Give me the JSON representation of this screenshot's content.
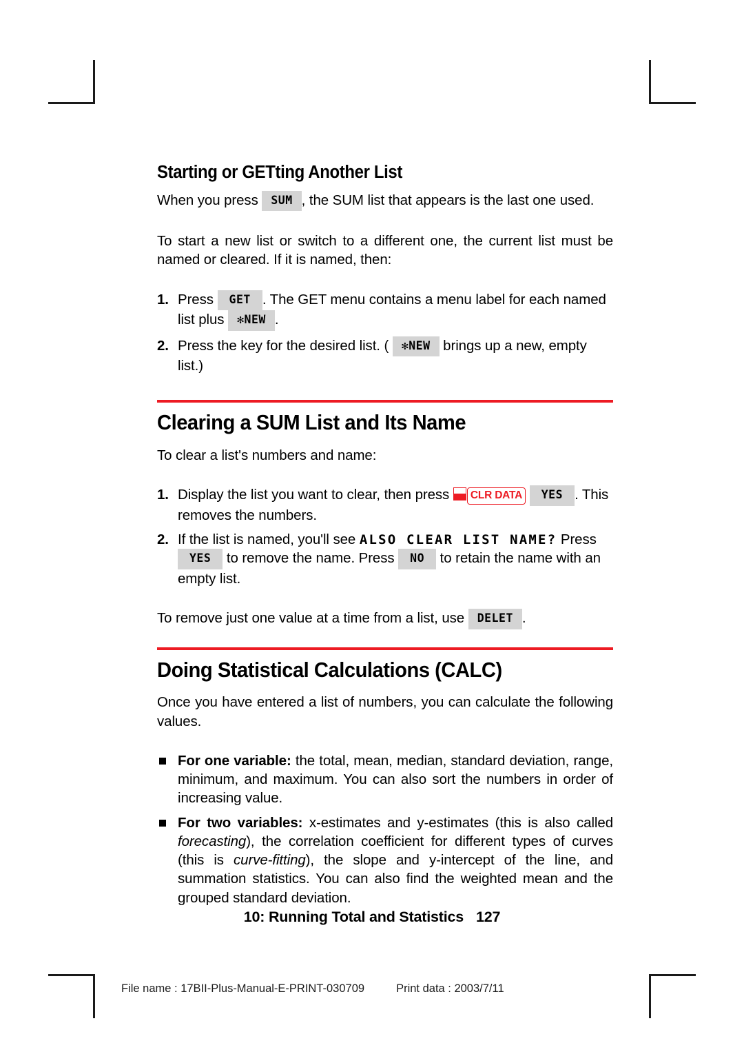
{
  "document": {
    "page_number": "127",
    "running_footer": "10: Running Total and Statistics",
    "print_footer": {
      "file_name_label": "File name : 17BII-Plus-Manual-E-PRINT-030709",
      "print_date_label": "Print data : 2003/7/11"
    },
    "accent_color": "#ED1B23",
    "key_bg_color": "#D4D4D4"
  },
  "sections": [
    {
      "id": "starting-or-getting",
      "heading": "Starting or GETting Another List",
      "intro": {
        "pre": "When you press",
        "key": "SUM",
        "post": ", the SUM list that appears is the last one used."
      },
      "paragraph": "To start a new list or switch to a different one, the current list must be named or cleared. If it is named, then:",
      "steps": [
        {
          "num": "1.",
          "t1": "Press",
          "k1": "GET",
          "t2": ". The GET menu contains a menu label for each named list plus",
          "k2": "✻NEW",
          "t3": "."
        },
        {
          "num": "2.",
          "t1": "Press the key for the desired list. (",
          "k1": "✻NEW",
          "t2": "brings up a new, empty list.)"
        }
      ]
    },
    {
      "id": "clearing-sum-list",
      "heading": "Clearing a SUM List and Its Name",
      "paragraph": "To clear a list's numbers and name:",
      "steps": [
        {
          "num": "1.",
          "t1": "Display the list you want to clear, then press",
          "shift": "shift",
          "redkey": "CLR DATA",
          "k1": "YES",
          "t2": ". This removes the numbers."
        },
        {
          "num": "2.",
          "t1": "If the list is named, you'll see",
          "lcd": "ALSO CLEAR LIST NAME?",
          "t2": "Press",
          "k1": "YES",
          "t3": "to remove the name. Press",
          "k2": "NO",
          "t4": "to retain the name with an empty list."
        }
      ],
      "closing": {
        "pre": "To remove just one value at a time from a list, use",
        "key": "DELET",
        "post": "."
      }
    },
    {
      "id": "doing-statistical-calculations",
      "heading": "Doing Statistical Calculations (CALC)",
      "paragraph": "Once you have entered a list of numbers, you can calculate the following values.",
      "bullets": [
        {
          "lead": "For one variable:",
          "body": " the total, mean, median, standard deviation, range, minimum, and maximum. You can also sort the numbers in order of increasing value."
        },
        {
          "lead": "For two variables:",
          "p1": " x-estimates and y-estimates (this is also called ",
          "i1": "forecasting",
          "p2": "), the correlation coefficient for different types of curves (this is ",
          "i2": "curve-fitting",
          "p3": "), the slope and y-intercept of the line, and summation statistics. You can also find the weighted mean and the grouped standard deviation."
        }
      ]
    }
  ]
}
